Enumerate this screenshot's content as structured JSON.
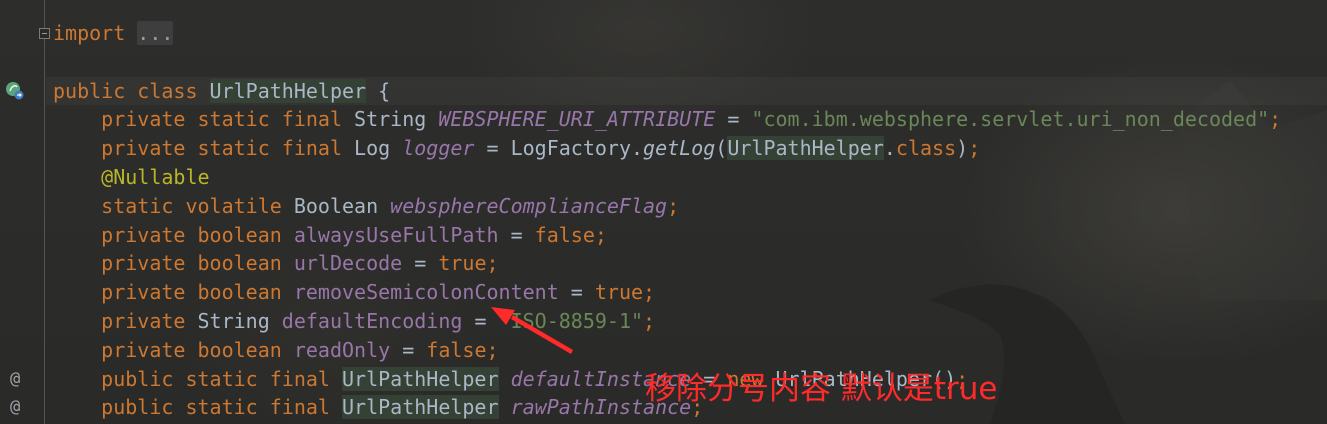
{
  "theme": {
    "keyword": "#cc7832",
    "text": "#a9b7c6",
    "field": "#9876aa",
    "string": "#6a8759",
    "annotation": "#bbb529",
    "usage_highlight": "#344134",
    "annotation_red": "#ff2a2a"
  },
  "editor": {
    "lines": [
      {
        "gutter_icon": "fold-icon",
        "tokens": [
          {
            "type": "keyword",
            "text": "import"
          },
          {
            "type": "plain",
            "text": " "
          },
          {
            "type": "folded",
            "text": "..."
          }
        ]
      },
      {
        "tokens": []
      },
      {
        "gutter_icon": "bean-icon",
        "current": true,
        "tokens": [
          {
            "type": "keyword",
            "text": "public class "
          },
          {
            "type": "class-ref",
            "text": "UrlPathHelper",
            "caret": true
          },
          {
            "type": "plain",
            "text": " {"
          }
        ]
      },
      {
        "tokens": [
          {
            "type": "keyword",
            "text": "    private static final "
          },
          {
            "type": "plain",
            "text": "String "
          },
          {
            "type": "static-field",
            "text": "WEBSPHERE_URI_ATTRIBUTE"
          },
          {
            "type": "plain",
            "text": " = "
          },
          {
            "type": "string",
            "text": "\"com.ibm.websphere.servlet.uri_non_decoded\""
          },
          {
            "type": "keyword",
            "text": ";"
          }
        ]
      },
      {
        "tokens": [
          {
            "type": "keyword",
            "text": "    private static final "
          },
          {
            "type": "plain",
            "text": "Log "
          },
          {
            "type": "static-field",
            "text": "logger"
          },
          {
            "type": "plain",
            "text": " = LogFactory."
          },
          {
            "type": "method-call",
            "text": "getLog"
          },
          {
            "type": "plain",
            "text": "("
          },
          {
            "type": "class-ref",
            "text": "UrlPathHelper"
          },
          {
            "type": "plain",
            "text": "."
          },
          {
            "type": "keyword",
            "text": "class"
          },
          {
            "type": "plain",
            "text": ")"
          },
          {
            "type": "keyword",
            "text": ";"
          }
        ]
      },
      {
        "tokens": [
          {
            "type": "annotation",
            "text": "    @Nullable"
          }
        ]
      },
      {
        "tokens": [
          {
            "type": "keyword",
            "text": "    static volatile "
          },
          {
            "type": "plain",
            "text": "Boolean "
          },
          {
            "type": "static-field",
            "text": "websphereComplianceFlag"
          },
          {
            "type": "keyword",
            "text": ";"
          }
        ]
      },
      {
        "tokens": [
          {
            "type": "keyword",
            "text": "    private boolean "
          },
          {
            "type": "field",
            "text": "alwaysUseFullPath"
          },
          {
            "type": "plain",
            "text": " = "
          },
          {
            "type": "keyword",
            "text": "false;"
          }
        ]
      },
      {
        "tokens": [
          {
            "type": "keyword",
            "text": "    private boolean "
          },
          {
            "type": "field",
            "text": "urlDecode"
          },
          {
            "type": "plain",
            "text": " = "
          },
          {
            "type": "keyword",
            "text": "true;"
          }
        ]
      },
      {
        "tokens": [
          {
            "type": "keyword",
            "text": "    private boolean "
          },
          {
            "type": "field",
            "text": "removeSemicolonContent"
          },
          {
            "type": "plain",
            "text": " = "
          },
          {
            "type": "keyword",
            "text": "true;"
          }
        ]
      },
      {
        "tokens": [
          {
            "type": "keyword",
            "text": "    private "
          },
          {
            "type": "plain",
            "text": "String "
          },
          {
            "type": "field",
            "text": "defaultEncoding"
          },
          {
            "type": "plain",
            "text": " = "
          },
          {
            "type": "string",
            "text": "\"ISO-8859-1\""
          },
          {
            "type": "keyword",
            "text": ";"
          }
        ]
      },
      {
        "tokens": [
          {
            "type": "keyword",
            "text": "    private boolean "
          },
          {
            "type": "field",
            "text": "readOnly"
          },
          {
            "type": "plain",
            "text": " = "
          },
          {
            "type": "keyword",
            "text": "false;"
          }
        ]
      },
      {
        "gutter_marker": "@",
        "tokens": [
          {
            "type": "keyword",
            "text": "    public static final "
          },
          {
            "type": "class-ref",
            "text": "UrlPathHelper"
          },
          {
            "type": "plain",
            "text": " "
          },
          {
            "type": "static-field",
            "text": "defaultInstance"
          },
          {
            "type": "plain",
            "text": " = "
          },
          {
            "type": "keyword",
            "text": "new "
          },
          {
            "type": "plain",
            "text": "UrlPathHelper()"
          },
          {
            "type": "keyword",
            "text": ";"
          }
        ]
      },
      {
        "gutter_marker": "@",
        "tokens": [
          {
            "type": "keyword",
            "text": "    public static final "
          },
          {
            "type": "class-ref",
            "text": "UrlPathHelper"
          },
          {
            "type": "plain",
            "text": " "
          },
          {
            "type": "static-field",
            "text": "rawPathInstance"
          },
          {
            "type": "keyword",
            "text": ";"
          }
        ]
      }
    ]
  },
  "annotation": {
    "text": "移除分号内容 默认是true"
  }
}
